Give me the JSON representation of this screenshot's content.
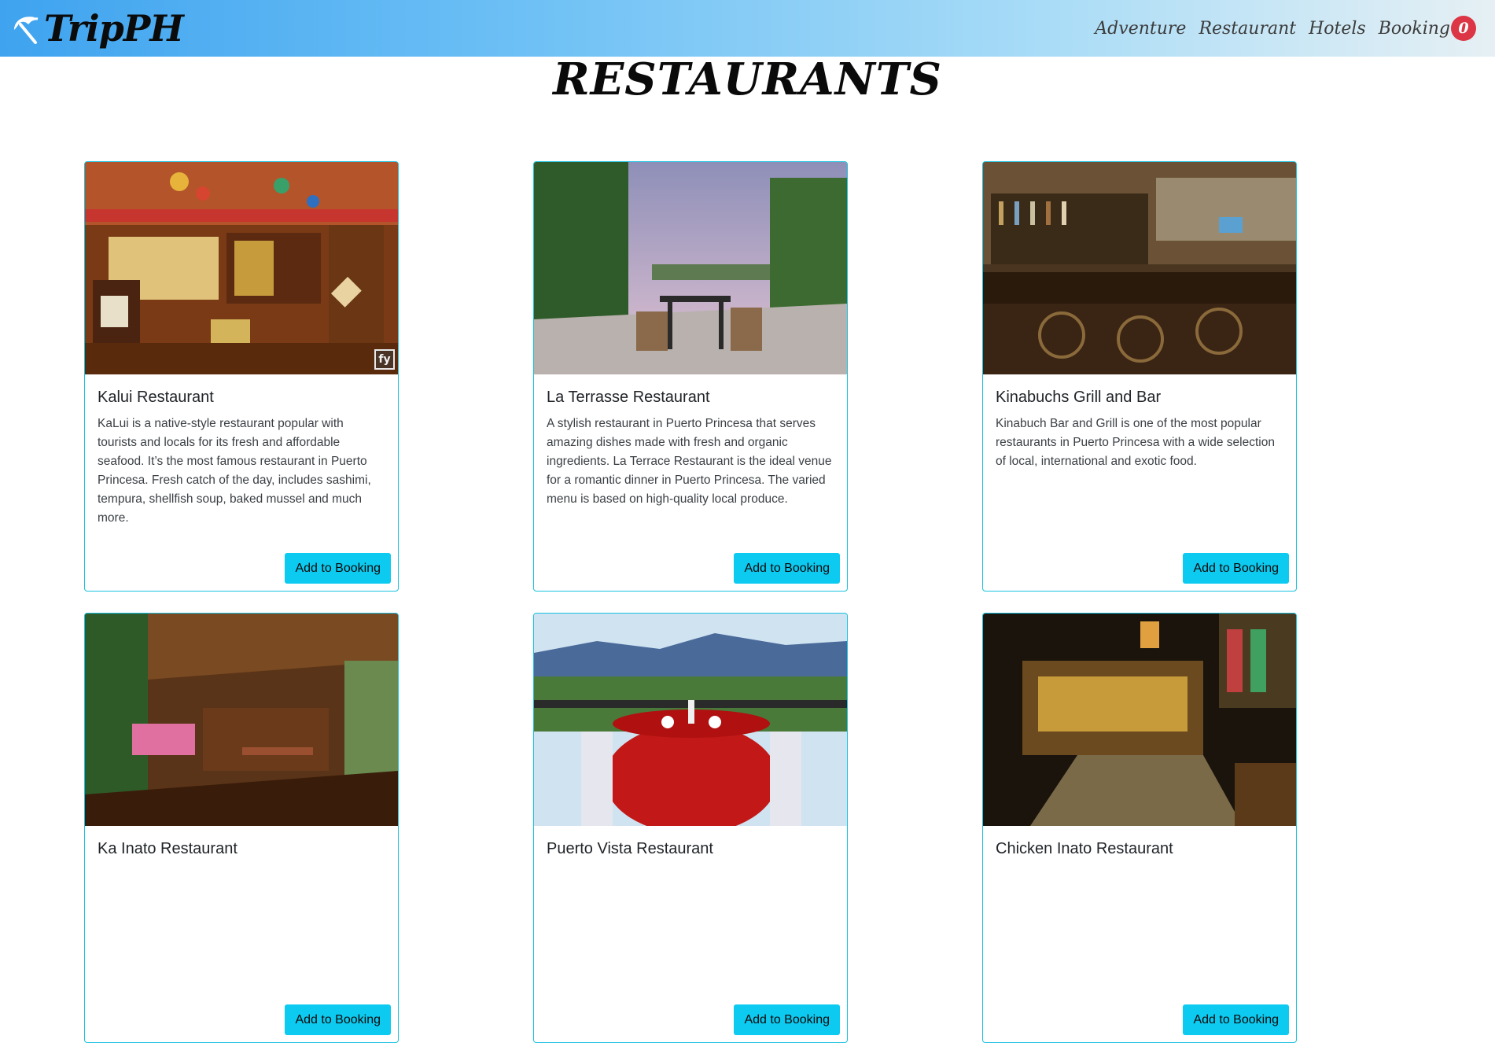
{
  "navbar": {
    "brand": "TripPH",
    "links": [
      {
        "label": "Adventure"
      },
      {
        "label": "Restaurant"
      },
      {
        "label": "Hotels"
      }
    ],
    "booking": {
      "label": "Booking",
      "count": "0"
    }
  },
  "page": {
    "title": "RESTAURANTS"
  },
  "colors": {
    "accent": "#0dcaf0",
    "card_border": "#17c1e0",
    "badge": "#dc3545"
  },
  "cards": [
    {
      "title": "Kalui Restaurant",
      "text": "KaLui is a native-style restaurant popular with tourists and locals for its fresh and affordable seafood. It’s the most famous restaurant in Puerto Princesa. Fresh catch of the day, includes sashimi, tempura, shellfish soup, baked mussel and much more.",
      "button": "Add to Booking",
      "image": "kalui-restaurant-interior",
      "watermark": "fy"
    },
    {
      "title": "La Terrasse Restaurant",
      "text": "A stylish restaurant in Puerto Princesa that serves amazing dishes made with fresh and organic ingredients. La Terrace Restaurant is the ideal venue for a romantic dinner in Puerto Princesa. The varied menu is based on high-quality local produce.",
      "button": "Add to Booking",
      "image": "la-terrasse-terrace"
    },
    {
      "title": "Kinabuchs Grill and Bar",
      "text": "Kinabuch Bar and Grill is one of the most popular restaurants in Puerto Princesa with a wide selection of local, international and exotic food.",
      "button": "Add to Booking",
      "image": "kinabuchs-bar-interior"
    },
    {
      "title": "Ka Inato Restaurant",
      "text": "",
      "button": "Add to Booking",
      "image": "ka-inato-wooden-hall"
    },
    {
      "title": "Puerto Vista Restaurant",
      "text": "",
      "button": "Add to Booking",
      "image": "puerto-vista-red-table"
    },
    {
      "title": "Chicken Inato Restaurant",
      "text": "",
      "button": "Add to Booking",
      "image": "chicken-inato-night"
    }
  ]
}
